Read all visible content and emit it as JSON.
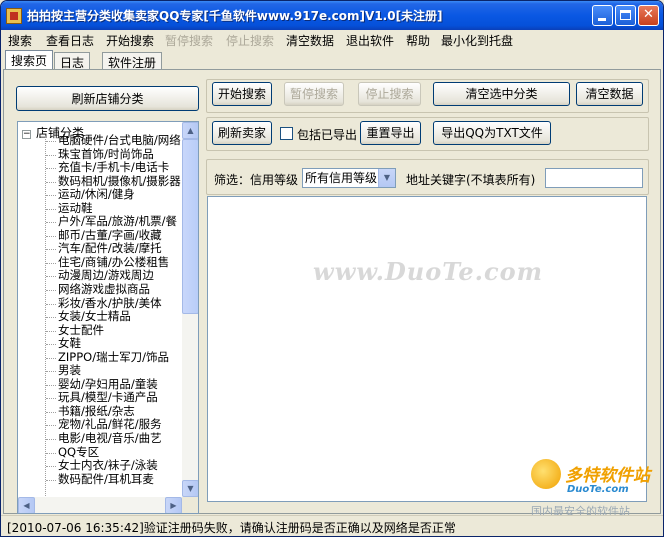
{
  "window": {
    "title": "拍拍按主营分类收集卖家QQ专家[千鱼软件www.917e.com]V1.0[未注册]"
  },
  "menu": {
    "items": [
      {
        "label": "搜索",
        "enabled": true
      },
      {
        "label": "查看日志",
        "enabled": true
      },
      {
        "label": "开始搜索",
        "enabled": true
      },
      {
        "label": "暂停搜索",
        "enabled": false
      },
      {
        "label": "停止搜索",
        "enabled": false
      },
      {
        "label": "清空数据",
        "enabled": true
      },
      {
        "label": "退出软件",
        "enabled": true
      },
      {
        "label": "帮助",
        "enabled": true
      },
      {
        "label": "最小化到托盘",
        "enabled": true
      }
    ]
  },
  "tabs": [
    {
      "label": "搜索页",
      "active": true
    },
    {
      "label": "日志",
      "active": false
    },
    {
      "label": "软件注册",
      "active": false
    }
  ],
  "left": {
    "refresh_button": "刷新店铺分类",
    "tree": {
      "root": "店铺分类",
      "expander": "−",
      "items": [
        "电脑硬件/台式电脑/网络",
        "珠宝首饰/时尚饰品",
        "充值卡/手机卡/电话卡",
        "数码相机/摄像机/摄影器",
        "运动/休闲/健身",
        "运动鞋",
        "户外/军品/旅游/机票/餐",
        "邮币/古董/字画/收藏",
        "汽车/配件/改装/摩托",
        "住宅/商铺/办公楼租售",
        "动漫周边/游戏周边",
        "网络游戏虚拟商品",
        "彩妆/香水/护肤/美体",
        "女装/女士精品",
        "女士配件",
        "女鞋",
        "ZIPPO/瑞士军刀/饰品",
        "男装",
        "婴幼/孕妇用品/童装",
        "玩具/模型/卡通产品",
        "书籍/报纸/杂志",
        "宠物/礼品/鲜花/服务",
        "电影/电视/音乐/曲艺",
        "QQ专区",
        "女士内衣/袜子/泳装",
        "数码配件/耳机耳麦"
      ]
    }
  },
  "toolbar": {
    "start_search": "开始搜索",
    "pause_search": "暂停搜索",
    "stop_search": "停止搜索",
    "clear_selected_category": "清空选中分类",
    "clear_data": "清空数据",
    "refresh_sellers": "刷新卖家",
    "include_exported_label": "包括已导出",
    "include_exported_checked": false,
    "reset_export": "重置导出",
    "export_qq_txt": "导出QQ为TXT文件"
  },
  "filter": {
    "label": "筛选：信用等级",
    "credit_level_selected": "所有信用等级",
    "address_keyword_label": "地址关键字(不填表所有)",
    "address_keyword_value": ""
  },
  "watermark": "www.DuoTe.com",
  "brand": {
    "name": "多特软件站",
    "site": "DuoTe.com",
    "slogan": "国内最安全的软件站"
  },
  "status": {
    "text": "[2010-07-06 16:35:42]验证注册码失败，请确认注册码是否正确以及网络是否正常"
  }
}
